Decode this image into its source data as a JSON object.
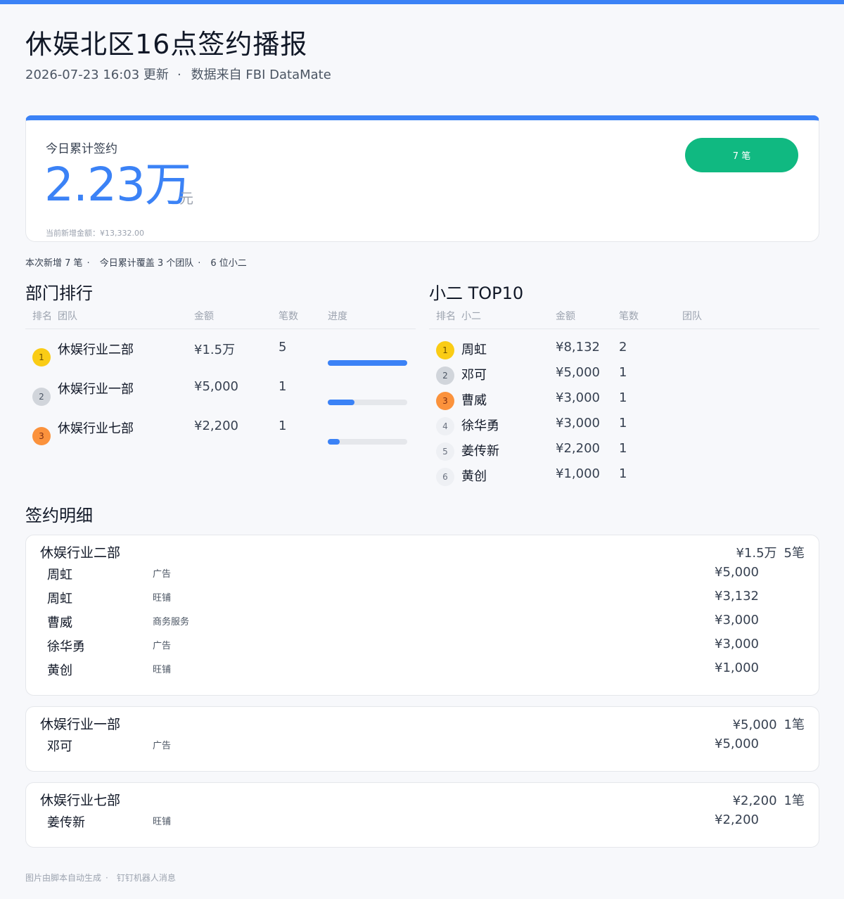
{
  "header": {
    "title": "休娱北区16点签约播报",
    "updated": "2026-07-23  16:03 更新",
    "source": "数据来自 FBI DataMate"
  },
  "summary": {
    "label": "今日累计签约",
    "value": "2.23万",
    "unit": "元",
    "note": "当前新增金额：¥13,332.00",
    "count": "7 笔"
  },
  "stats": [
    "本次新增 7 笔",
    "今日累计覆盖 3 个团队",
    "6 位小二"
  ],
  "departments": {
    "title": "部门排行",
    "headers": [
      "排名",
      "团队",
      "金额",
      "笔数",
      "进度"
    ],
    "rows": [
      {
        "rank": "1",
        "team": "休娱行业二部",
        "amount": "¥1.5万",
        "count": "5",
        "progress": 1.0
      },
      {
        "rank": "2",
        "team": "休娱行业一部",
        "amount": "¥5,000",
        "count": "1",
        "progress": 0.333
      },
      {
        "rank": "3",
        "team": "休娱行业七部",
        "amount": "¥2,200",
        "count": "1",
        "progress": 0.147
      }
    ]
  },
  "top10": {
    "title": "小二 TOP10",
    "headers": [
      "排名",
      "小二",
      "金额",
      "笔数",
      "团队"
    ],
    "rows": [
      {
        "rank": "1",
        "name": "周虹",
        "amount": "¥8,132",
        "count": "2"
      },
      {
        "rank": "2",
        "name": "邓可",
        "amount": "¥5,000",
        "count": "1"
      },
      {
        "rank": "3",
        "name": "曹威",
        "amount": "¥3,000",
        "count": "1"
      },
      {
        "rank": "4",
        "name": "徐华勇",
        "amount": "¥3,000",
        "count": "1"
      },
      {
        "rank": "5",
        "name": "姜传新",
        "amount": "¥2,200",
        "count": "1"
      },
      {
        "rank": "6",
        "name": "黄创",
        "amount": "¥1,000",
        "count": "1"
      }
    ]
  },
  "details": {
    "title": "签约明细",
    "groups": [
      {
        "name": "休娱行业二部",
        "total": "¥1.5万",
        "count": "5笔",
        "items": [
          {
            "name": "周虹",
            "category": "广告",
            "amount": "¥5,000"
          },
          {
            "name": "周虹",
            "category": "旺铺",
            "amount": "¥3,132"
          },
          {
            "name": "曹威",
            "category": "商务服务",
            "amount": "¥3,000"
          },
          {
            "name": "徐华勇",
            "category": "广告",
            "amount": "¥3,000"
          },
          {
            "name": "黄创",
            "category": "旺铺",
            "amount": "¥1,000"
          }
        ]
      },
      {
        "name": "休娱行业一部",
        "total": "¥5,000",
        "count": "1笔",
        "items": [
          {
            "name": "邓可",
            "category": "广告",
            "amount": "¥5,000"
          }
        ]
      },
      {
        "name": "休娱行业七部",
        "total": "¥2,200",
        "count": "1笔",
        "items": [
          {
            "name": "姜传新",
            "category": "旺铺",
            "amount": "¥2,200"
          }
        ]
      }
    ]
  },
  "footer": [
    "图片由脚本自动生成",
    "钉钉机器人消息"
  ],
  "colors": {
    "accent": "#3b82f6",
    "success": "#10b981",
    "gold": "#facc15",
    "silver": "#d1d5db",
    "bronze": "#fb923c"
  }
}
